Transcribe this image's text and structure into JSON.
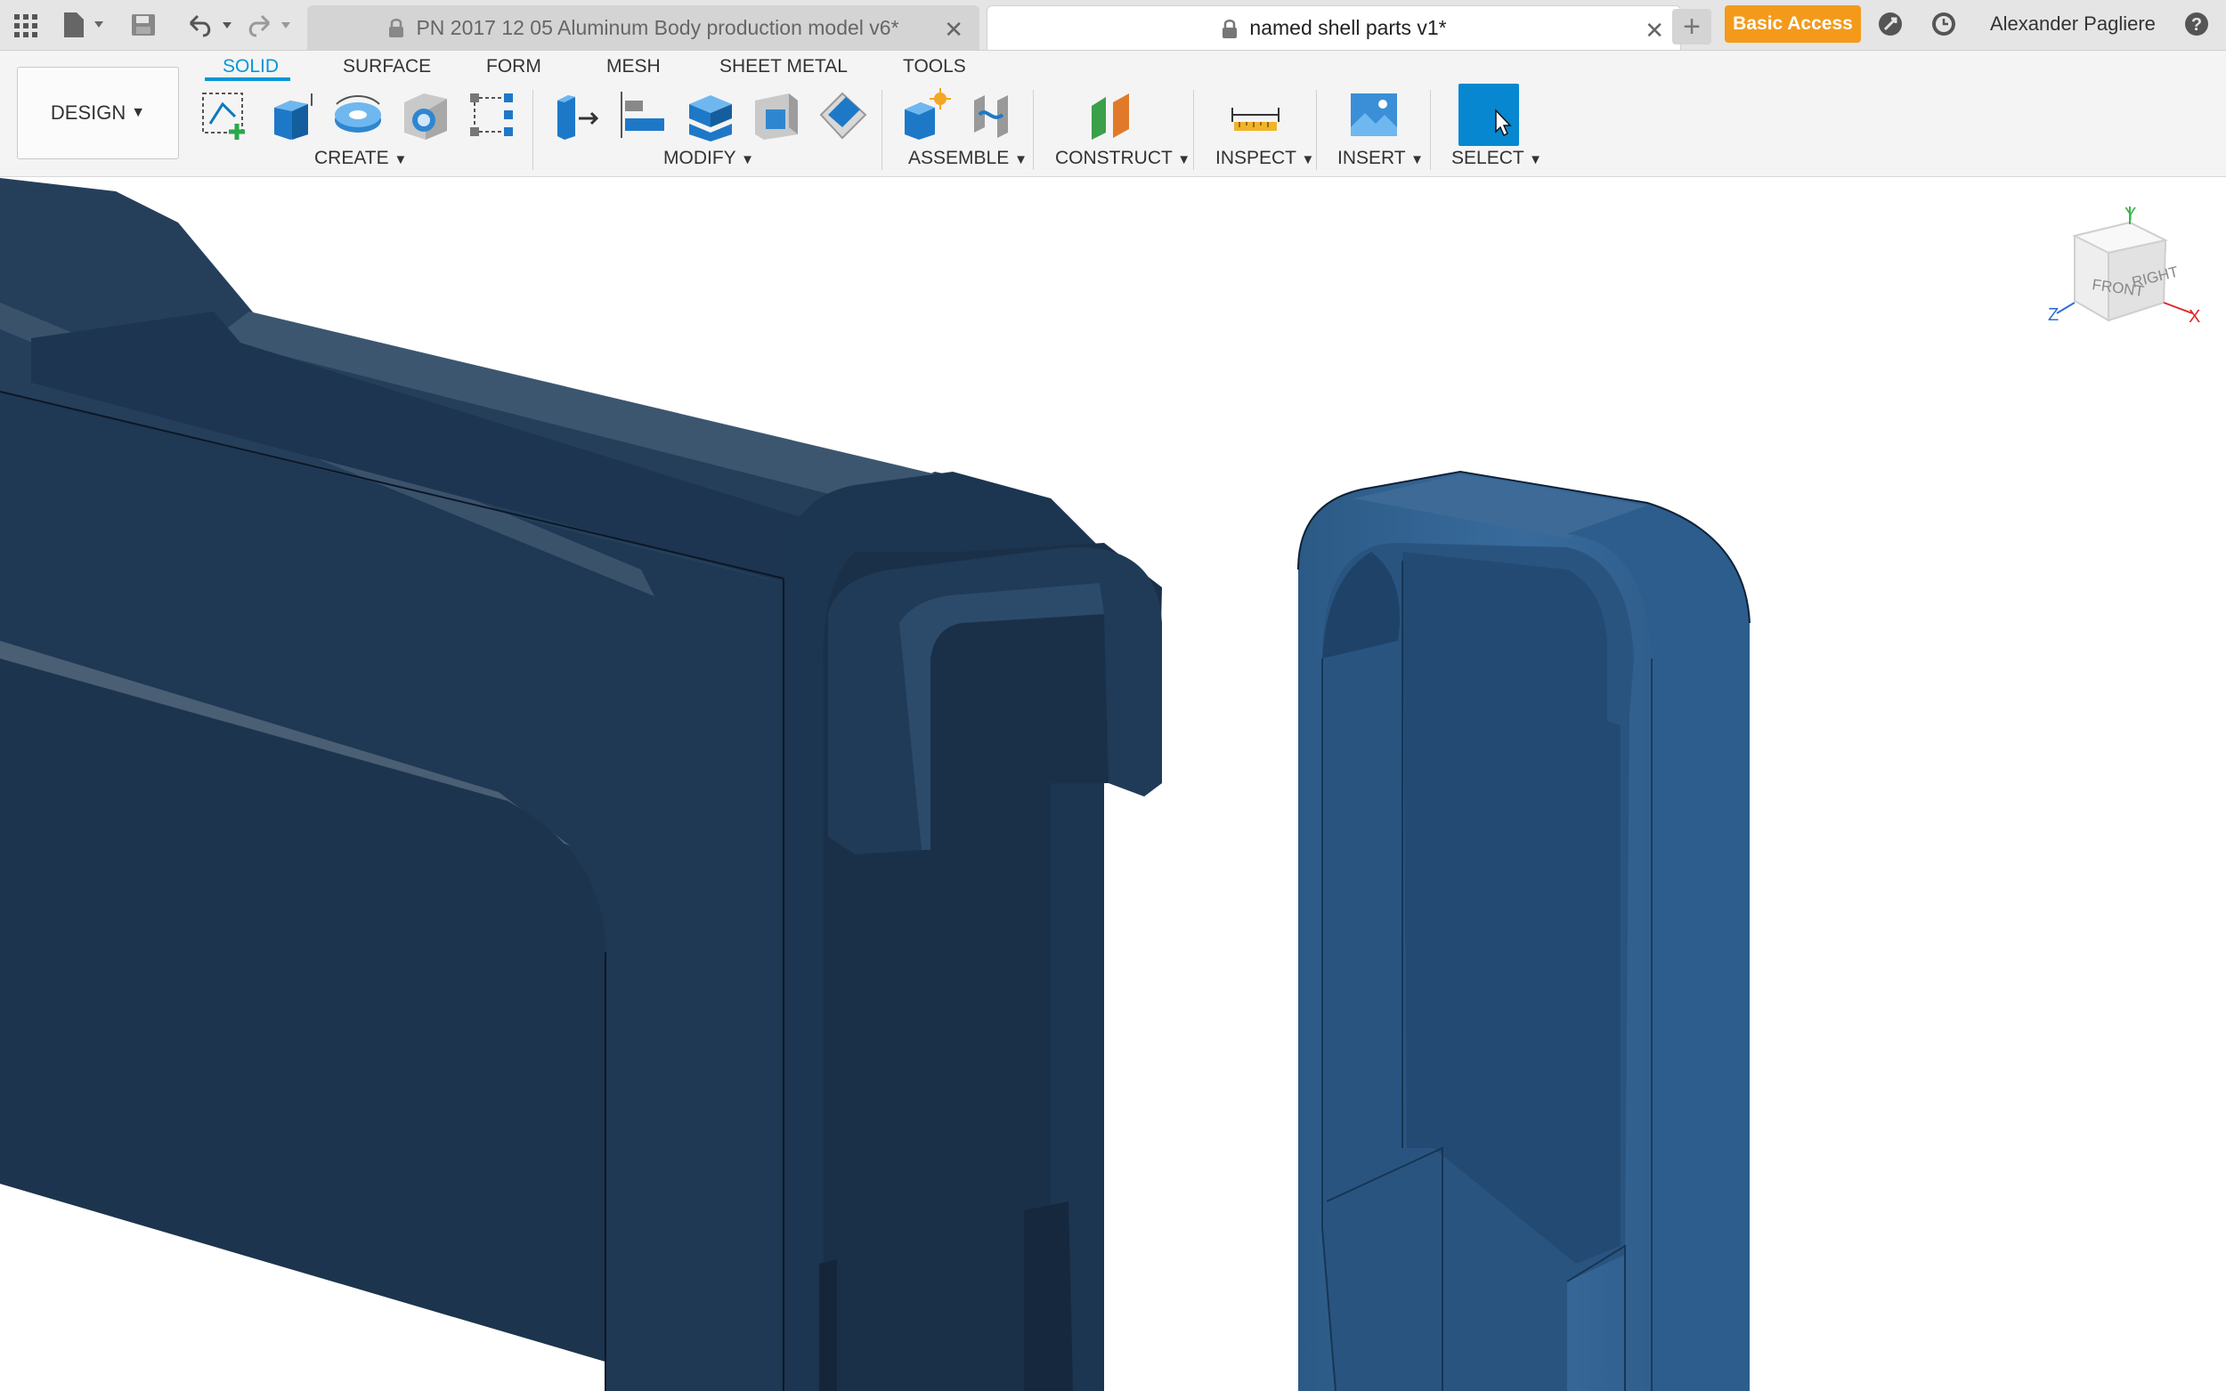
{
  "topbar": {
    "tabs": [
      {
        "title": "PN 2017 12 05 Aluminum Body production model v6*",
        "active": false
      },
      {
        "title": "named shell parts v1*",
        "active": true
      }
    ],
    "basic_access_label": "Basic Access",
    "user_name": "Alexander Pagliere",
    "help_label": "?",
    "icons": [
      "grid-icon",
      "file-icon",
      "save-icon",
      "undo-icon",
      "redo-icon",
      "lock-icon",
      "close-icon",
      "plus-icon",
      "job-status-icon",
      "clock-icon",
      "help-icon"
    ],
    "colors": {
      "accent": "#0696d7",
      "basic_access": "#f39a1b"
    }
  },
  "toolbar": {
    "workspace_label": "DESIGN",
    "tabs": [
      "SOLID",
      "SURFACE",
      "FORM",
      "MESH",
      "SHEET METAL",
      "TOOLS"
    ],
    "active_tab": "SOLID",
    "groups": [
      "CREATE",
      "MODIFY",
      "ASSEMBLE",
      "CONSTRUCT",
      "INSPECT",
      "INSERT",
      "SELECT"
    ]
  },
  "viewcube": {
    "front": "FRONT",
    "right": "RIGHT",
    "axis_x": "X",
    "axis_y": "Y",
    "axis_z": "Z"
  }
}
